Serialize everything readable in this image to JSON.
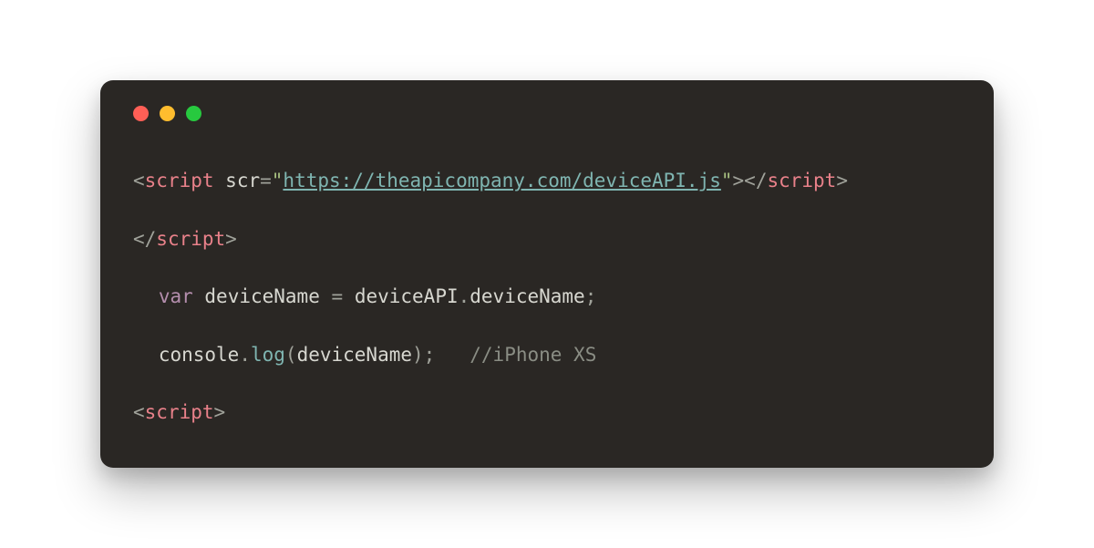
{
  "window": {
    "traffic_lights": [
      "red",
      "yellow",
      "green"
    ]
  },
  "code": {
    "line1": {
      "lt1": "<",
      "tag_open": "script",
      "space1": " ",
      "attr_name": "scr",
      "eq": "=",
      "quote_open": "\"",
      "url": "https://theapicompany.com/deviceAPI.js",
      "quote_close": "\"",
      "gt1": ">",
      "lt2": "</",
      "tag_close": "script",
      "gt2": ">"
    },
    "line2": {
      "lt": "</",
      "tag": "script",
      "gt": ">"
    },
    "line3": {
      "kw_var": "var",
      "space1": " ",
      "lhs": "deviceName",
      "space2": " ",
      "eq": "=",
      "space3": " ",
      "obj": "deviceAPI",
      "dot": ".",
      "prop": "deviceName",
      "semi": ";"
    },
    "line4": {
      "obj": "console",
      "dot": ".",
      "method": "log",
      "paren_open": "(",
      "arg": "deviceName",
      "paren_close": ")",
      "semi": ";",
      "gap": "   ",
      "comment": "//iPhone XS"
    },
    "line5": {
      "lt": "<",
      "tag": "script",
      "gt": ">"
    }
  }
}
